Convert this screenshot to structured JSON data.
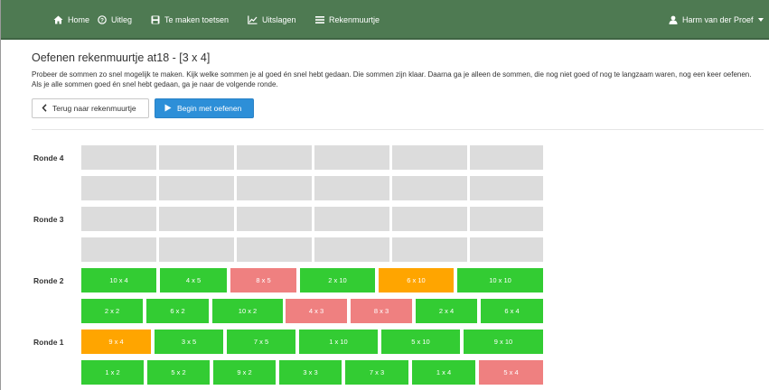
{
  "nav": {
    "home": "Home",
    "uitleg": "Uitleg",
    "toetsen": "Te maken toetsen",
    "uitslagen": "Uitslagen",
    "rekenmuurtje": "Rekenmuurtje",
    "user": "Harm van der Proef"
  },
  "page": {
    "title": "Oefenen rekenmuurtje at18 - [3 x 4]",
    "intro": "Probeer de sommen zo snel mogelijk te maken. Kijk welke sommen je al goed én snel hebt gedaan. Die sommen zijn klaar. Daarna ga je alleen de sommen, die nog niet goed of nog te langzaam waren, nog een keer oefenen. Als je alle sommen goed én snel hebt gedaan, ga je naar de volgende ronde.",
    "back_button": "Terug naar rekenmuurtje",
    "start_button": "Begin met oefenen"
  },
  "rounds": {
    "r4": "Ronde 4",
    "r3": "Ronde 3",
    "r2": "Ronde 2",
    "r1": "Ronde 1"
  },
  "status_colors": {
    "green": "#33cc33",
    "red": "#ef8080",
    "orange": "#ffa500",
    "empty": "#dcdcdc"
  },
  "ronde2_top": [
    {
      "label": "10 x 4",
      "status": "green"
    },
    {
      "label": "4 x 5",
      "status": "green"
    },
    {
      "label": "8 x 5",
      "status": "red"
    },
    {
      "label": "2 x 10",
      "status": "green"
    },
    {
      "label": "6 x 10",
      "status": "orange"
    },
    {
      "label": "10 x 10",
      "status": "green"
    }
  ],
  "ronde2_bottom": [
    {
      "label": "2 x 2",
      "status": "green"
    },
    {
      "label": "6 x 2",
      "status": "green"
    },
    {
      "label": "10 x 2",
      "status": "green"
    },
    {
      "label": "4 x 3",
      "status": "red"
    },
    {
      "label": "8 x 3",
      "status": "red"
    },
    {
      "label": "2 x 4",
      "status": "green"
    },
    {
      "label": "6 x 4",
      "status": "green"
    }
  ],
  "ronde1_top": [
    {
      "label": "9 x 4",
      "status": "orange"
    },
    {
      "label": "3 x 5",
      "status": "green"
    },
    {
      "label": "7 x 5",
      "status": "green"
    },
    {
      "label": "1 x 10",
      "status": "green"
    },
    {
      "label": "5 x 10",
      "status": "green"
    },
    {
      "label": "9 x 10",
      "status": "green"
    }
  ],
  "ronde1_bottom": [
    {
      "label": "1 x 2",
      "status": "green"
    },
    {
      "label": "5 x 2",
      "status": "green"
    },
    {
      "label": "9 x 2",
      "status": "green"
    },
    {
      "label": "3 x 3",
      "status": "green"
    },
    {
      "label": "7 x 3",
      "status": "green"
    },
    {
      "label": "1 x 4",
      "status": "green"
    },
    {
      "label": "5 x 4",
      "status": "red"
    }
  ]
}
